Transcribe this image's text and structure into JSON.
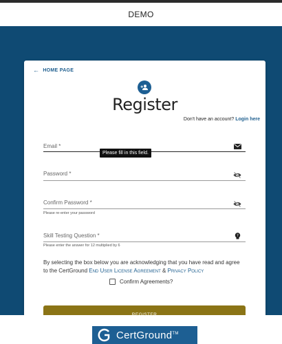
{
  "header": {
    "title": "DEMO"
  },
  "card": {
    "home_link": "HOME PAGE",
    "title": "Register",
    "signin_prompt": "Don't have an account?",
    "login_link": "Login here"
  },
  "form": {
    "email": {
      "label": "Email *",
      "icon": "envelope-icon"
    },
    "tooltip": "Please fill in this field.",
    "password": {
      "label": "Password *",
      "icon": "visibility-off-icon"
    },
    "confirm_password": {
      "label": "Confirm Password *",
      "helper": "Please re-enter your password",
      "icon": "visibility-off-icon"
    },
    "skill_question": {
      "label": "Skill Testing Question *",
      "helper": "Please enter the answer for 12 multiplied by 6",
      "icon": "lightbulb-icon"
    },
    "agreement": {
      "text_before": "By selecting the box below you are acknowledging that you have read and agree to the CertGround ",
      "eula_link": "End User License Agreement",
      "ampersand": " & ",
      "privacy_link": "Privacy Policy"
    },
    "checkbox_label": "Confirm Agreements?",
    "submit_label": "REGISTER"
  },
  "footer": {
    "logo_text": "CertGround",
    "logo_tm": "TM"
  },
  "colors": {
    "hero_bg": "#0f4a73",
    "accent_blue": "#1f5f8f",
    "button_gold": "#8b7416"
  }
}
